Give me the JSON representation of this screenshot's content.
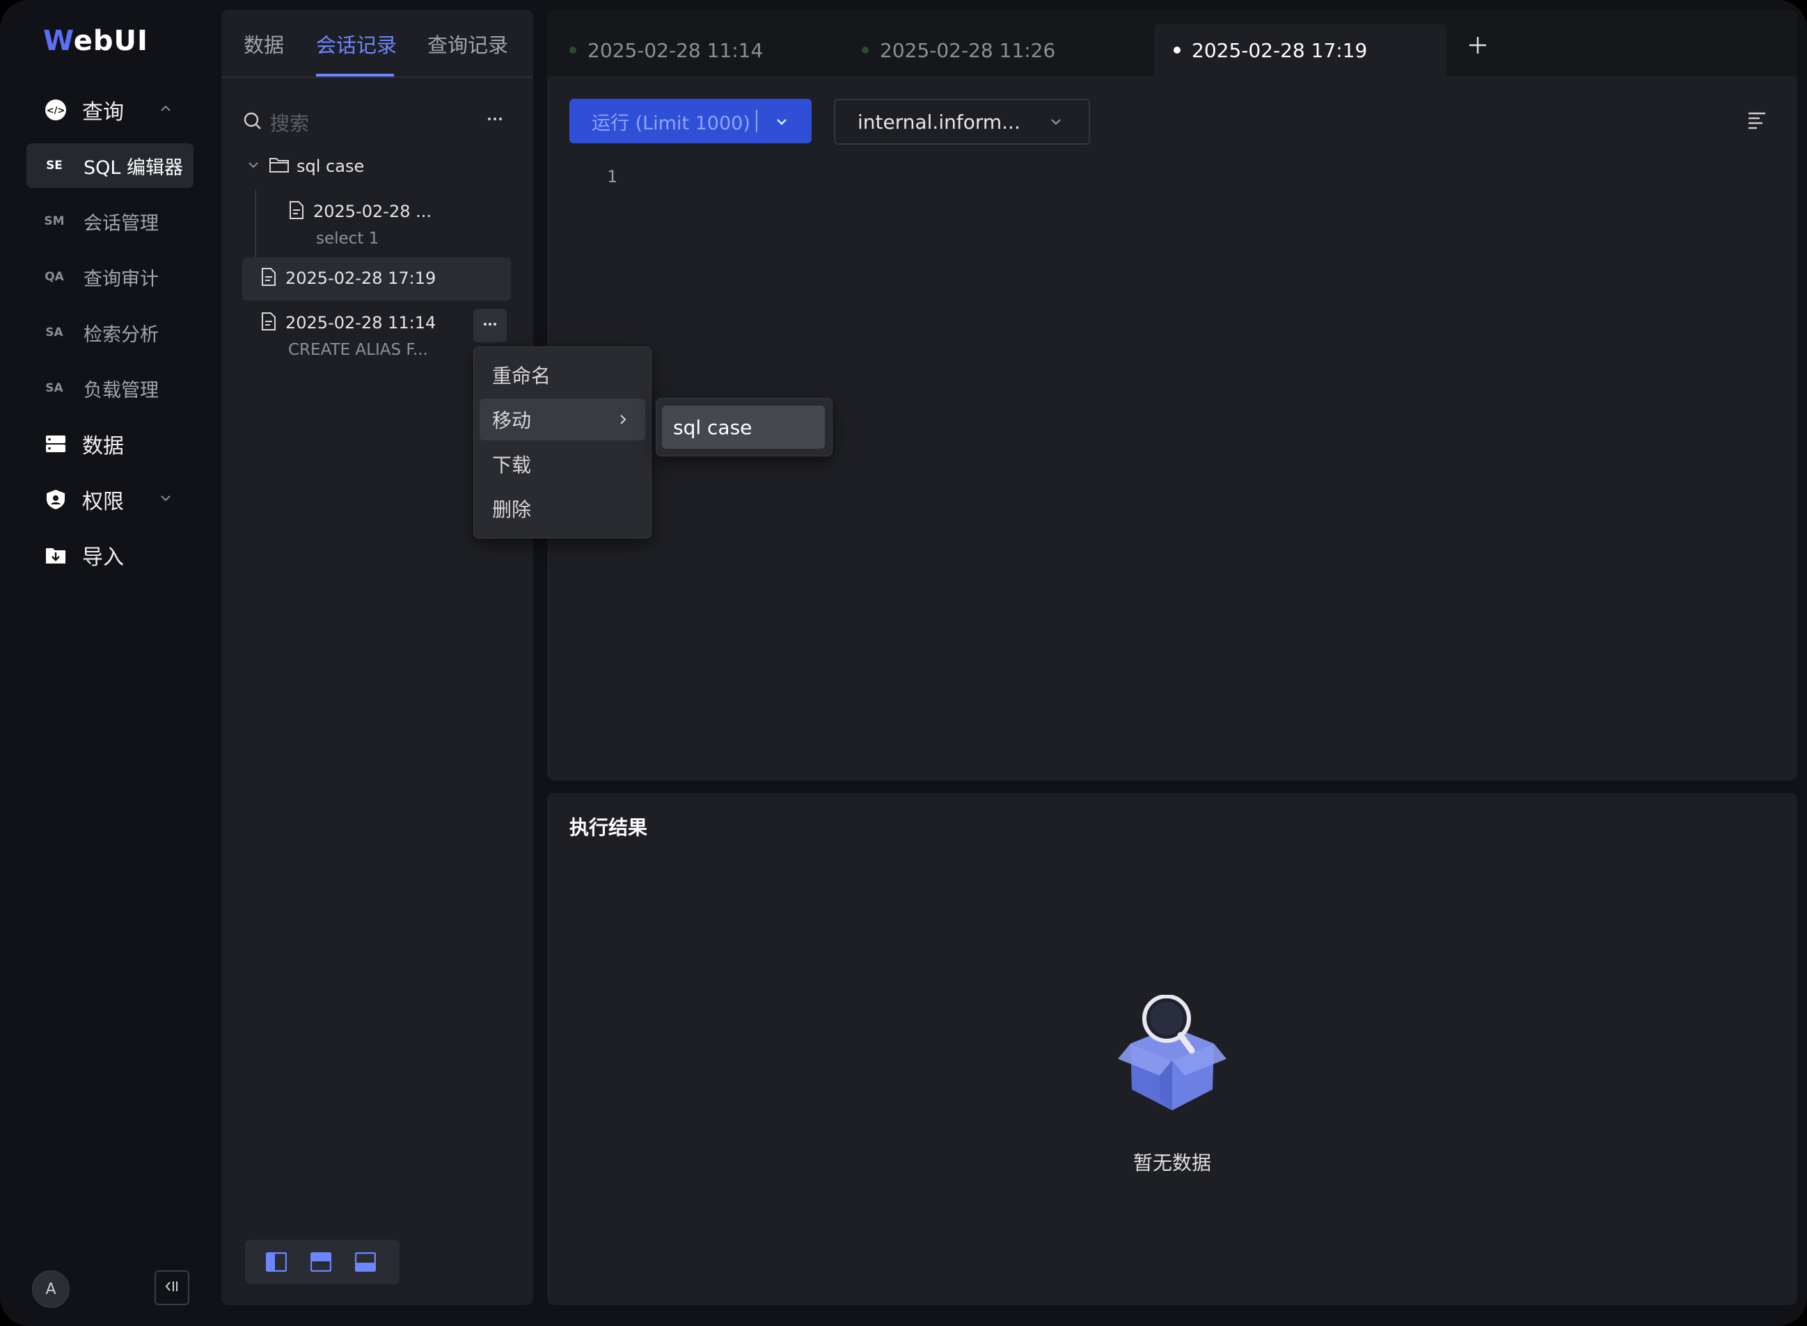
{
  "app": {
    "logo_first": "W",
    "logo_rest": "ebUI"
  },
  "nav": {
    "query": "查询",
    "sub": [
      {
        "abbr": "SE",
        "label": "SQL 编辑器"
      },
      {
        "abbr": "SM",
        "label": "会话管理"
      },
      {
        "abbr": "QA",
        "label": "查询审计"
      },
      {
        "abbr": "SA",
        "label": "检索分析"
      },
      {
        "abbr": "SA",
        "label": "负载管理"
      }
    ],
    "data": "数据",
    "permission": "权限",
    "import": "导入",
    "avatar": "A"
  },
  "panel": {
    "tabs": [
      "数据",
      "会话记录",
      "查询记录"
    ],
    "search_placeholder": "搜索",
    "folder": "sql case",
    "folder_file": {
      "name": "2025-02-28 ...",
      "sub": "select 1"
    },
    "file_selected": "2025-02-28 17:19",
    "file_other": {
      "name": "2025-02-28 11:14",
      "sub": "CREATE ALIAS F..."
    }
  },
  "context_menu": {
    "items": [
      "重命名",
      "移动",
      "下载",
      "删除"
    ],
    "submenu_item": "sql case"
  },
  "editor": {
    "tabs": [
      "2025-02-28 11:14",
      "2025-02-28 11:26",
      "2025-02-28 17:19"
    ],
    "run_label": "运行 (Limit 1000)",
    "db_label": "internal.inform...",
    "line_number": "1"
  },
  "results": {
    "title": "执行结果",
    "empty": "暂无数据"
  },
  "colors": {
    "accent": "#6c86ff",
    "run_button": "#2f4fd6",
    "background": "#111217",
    "panel": "#1e1f24"
  }
}
